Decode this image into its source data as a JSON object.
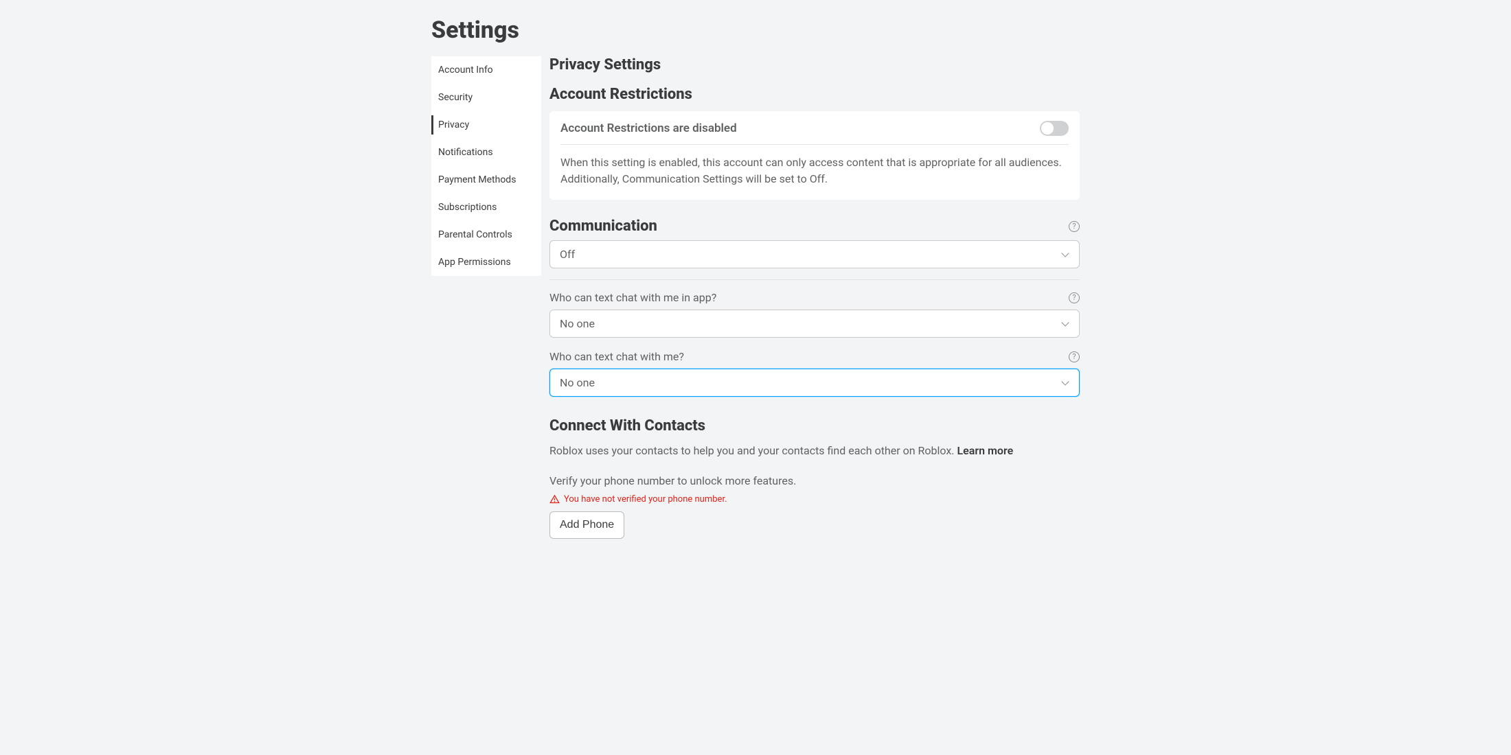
{
  "page": {
    "title": "Settings"
  },
  "sidebar": {
    "items": [
      {
        "label": "Account Info",
        "active": false
      },
      {
        "label": "Security",
        "active": false
      },
      {
        "label": "Privacy",
        "active": true
      },
      {
        "label": "Notifications",
        "active": false
      },
      {
        "label": "Payment Methods",
        "active": false
      },
      {
        "label": "Subscriptions",
        "active": false
      },
      {
        "label": "Parental Controls",
        "active": false
      },
      {
        "label": "App Permissions",
        "active": false
      }
    ]
  },
  "main": {
    "title": "Privacy Settings",
    "account_restrictions": {
      "heading": "Account Restrictions",
      "status_label": "Account Restrictions are disabled",
      "toggle_on": false,
      "description": "When this setting is enabled, this account can only access content that is appropriate for all audiences. Additionally, Communication Settings will be set to Off."
    },
    "communication": {
      "heading": "Communication",
      "main_select_value": "Off",
      "q1_label": "Who can text chat with me in app?",
      "q1_value": "No one",
      "q2_label": "Who can text chat with me?",
      "q2_value": "No one"
    },
    "contacts": {
      "heading": "Connect With Contacts",
      "description_prefix": "Roblox uses your contacts to help you and your contacts find each other on Roblox. ",
      "learn_more_label": "Learn more",
      "verify_text": "Verify your phone number to unlock more features.",
      "warning_text": "You have not verified your phone number.",
      "add_phone_button": "Add Phone"
    }
  }
}
